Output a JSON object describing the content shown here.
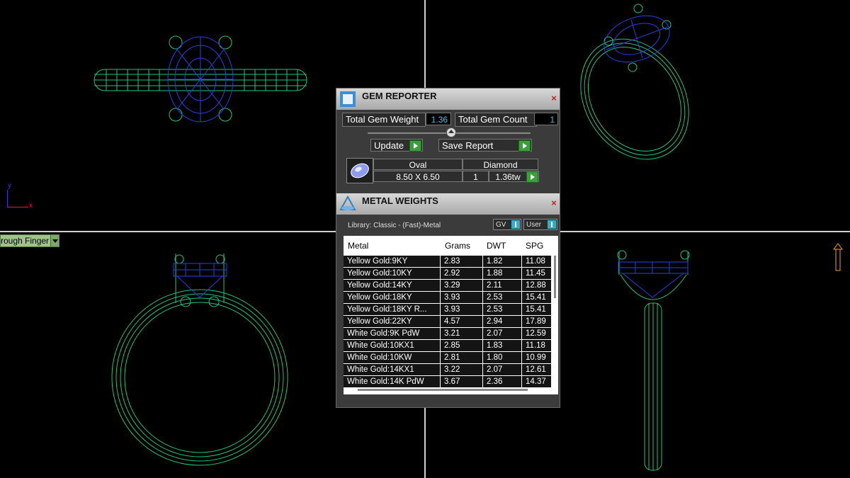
{
  "viewports": {
    "finger_button": "rough Finger"
  },
  "axes_labels": {
    "y": "y",
    "x": "x"
  },
  "gem_reporter": {
    "title": "GEM REPORTER",
    "total_gem_weight_label": "Total Gem Weight",
    "total_gem_weight_value": "1.36",
    "total_gem_count_label": "Total Gem Count",
    "total_gem_count_value": "1",
    "update_label": "Update",
    "save_report_label": "Save Report",
    "gem": {
      "shape": "Oval",
      "size": "8.50 X 6.50",
      "type": "Diamond",
      "count": "1",
      "weight": "1.36tw"
    }
  },
  "metal_weights": {
    "title": "METAL WEIGHTS",
    "library": "Library: Classic - (Fast)-Metal",
    "gv_label": "GV",
    "user_label": "User",
    "columns": [
      "Metal",
      "Grams",
      "DWT",
      "SPG"
    ],
    "rows": [
      [
        "Yellow Gold:9KY",
        "2.83",
        "1.82",
        "11.08"
      ],
      [
        "Yellow Gold:10KY",
        "2.92",
        "1.88",
        "11.45"
      ],
      [
        "Yellow Gold:14KY",
        "3.29",
        "2.11",
        "12.88"
      ],
      [
        "Yellow Gold:18KY",
        "3.93",
        "2.53",
        "15.41"
      ],
      [
        "Yellow Gold:18KY R...",
        "3.93",
        "2.53",
        "15.41"
      ],
      [
        "Yellow Gold:22KY",
        "4.57",
        "2.94",
        "17.89"
      ],
      [
        "White Gold:9K PdW",
        "3.21",
        "2.07",
        "12.59"
      ],
      [
        "White Gold:10KX1",
        "2.85",
        "1.83",
        "11.18"
      ],
      [
        "White Gold:10KW",
        "2.81",
        "1.80",
        "10.99"
      ],
      [
        "White Gold:14KX1",
        "3.22",
        "2.07",
        "12.61"
      ],
      [
        "White Gold:14K PdW",
        "3.67",
        "2.36",
        "14.37"
      ]
    ]
  },
  "colors": {
    "wire_green": "#1fc47a",
    "wire_blue": "#2a3fe0",
    "value_cyan": "#2fc3e6",
    "go_green": "#3aa13a"
  }
}
